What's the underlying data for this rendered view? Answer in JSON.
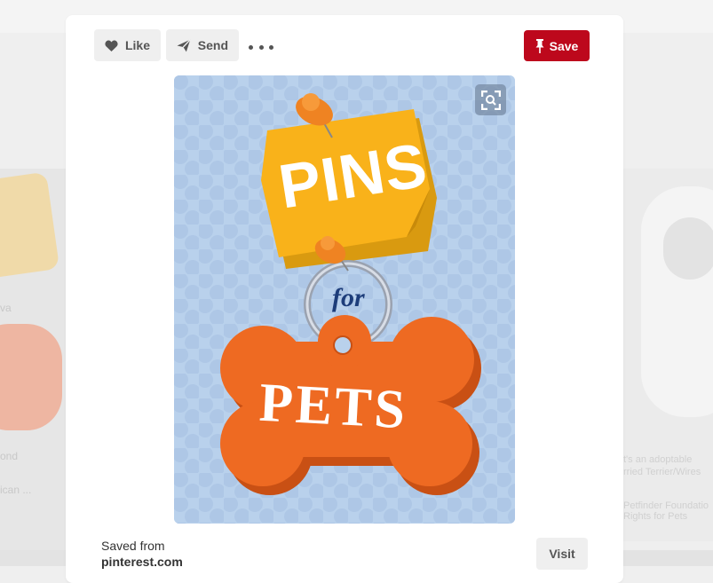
{
  "toolbar": {
    "like_label": "Like",
    "send_label": "Send",
    "save_label": "Save"
  },
  "pin": {
    "title_word_1": "PINS",
    "title_word_2": "for",
    "title_word_3": "PETS"
  },
  "footer": {
    "saved_from_label": "Saved from",
    "domain": "pinterest.com",
    "visit_label": "Visit"
  },
  "background": {
    "left_fragment_1": "va",
    "left_fragment_2": "ond",
    "left_fragment_3": "ican ...",
    "right_fragment_1": "t's an adoptable",
    "right_fragment_2": "rried Terrier/Wires",
    "right_fragment_3": "Petfinder Foundatio",
    "right_fragment_4": "Rights for Pets"
  },
  "colors": {
    "save_red": "#bd081c",
    "pin_background": "#b9d1ec",
    "sticky_note": "#f9b21a",
    "bone_orange": "#ee6a22"
  },
  "icons": {
    "like": "heart-icon",
    "send": "paper-plane-icon",
    "more": "ellipsis-icon",
    "save": "pushpin-icon",
    "zoom": "visual-search-icon"
  }
}
